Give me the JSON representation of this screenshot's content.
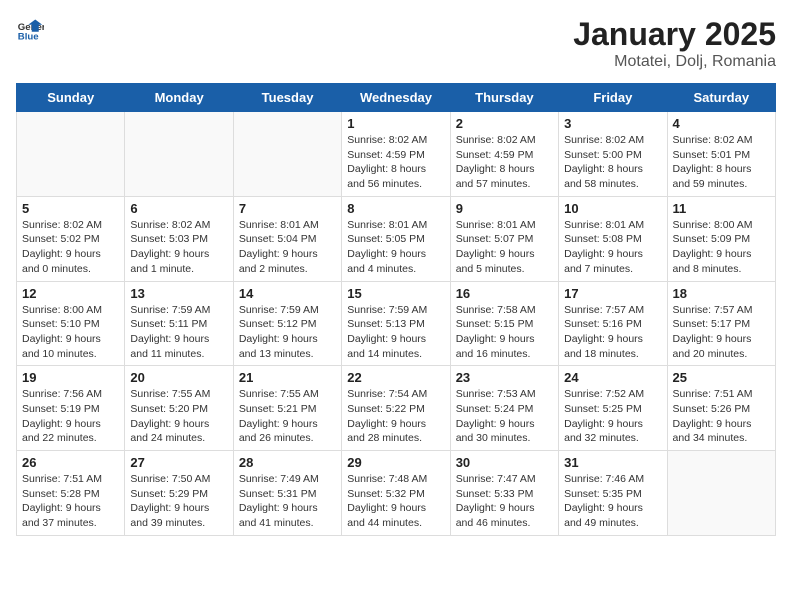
{
  "logo": {
    "text_general": "General",
    "text_blue": "Blue"
  },
  "title": "January 2025",
  "subtitle": "Motatei, Dolj, Romania",
  "weekdays": [
    "Sunday",
    "Monday",
    "Tuesday",
    "Wednesday",
    "Thursday",
    "Friday",
    "Saturday"
  ],
  "weeks": [
    [
      {
        "day": "",
        "detail": ""
      },
      {
        "day": "",
        "detail": ""
      },
      {
        "day": "",
        "detail": ""
      },
      {
        "day": "1",
        "detail": "Sunrise: 8:02 AM\nSunset: 4:59 PM\nDaylight: 8 hours\nand 56 minutes."
      },
      {
        "day": "2",
        "detail": "Sunrise: 8:02 AM\nSunset: 4:59 PM\nDaylight: 8 hours\nand 57 minutes."
      },
      {
        "day": "3",
        "detail": "Sunrise: 8:02 AM\nSunset: 5:00 PM\nDaylight: 8 hours\nand 58 minutes."
      },
      {
        "day": "4",
        "detail": "Sunrise: 8:02 AM\nSunset: 5:01 PM\nDaylight: 8 hours\nand 59 minutes."
      }
    ],
    [
      {
        "day": "5",
        "detail": "Sunrise: 8:02 AM\nSunset: 5:02 PM\nDaylight: 9 hours\nand 0 minutes."
      },
      {
        "day": "6",
        "detail": "Sunrise: 8:02 AM\nSunset: 5:03 PM\nDaylight: 9 hours\nand 1 minute."
      },
      {
        "day": "7",
        "detail": "Sunrise: 8:01 AM\nSunset: 5:04 PM\nDaylight: 9 hours\nand 2 minutes."
      },
      {
        "day": "8",
        "detail": "Sunrise: 8:01 AM\nSunset: 5:05 PM\nDaylight: 9 hours\nand 4 minutes."
      },
      {
        "day": "9",
        "detail": "Sunrise: 8:01 AM\nSunset: 5:07 PM\nDaylight: 9 hours\nand 5 minutes."
      },
      {
        "day": "10",
        "detail": "Sunrise: 8:01 AM\nSunset: 5:08 PM\nDaylight: 9 hours\nand 7 minutes."
      },
      {
        "day": "11",
        "detail": "Sunrise: 8:00 AM\nSunset: 5:09 PM\nDaylight: 9 hours\nand 8 minutes."
      }
    ],
    [
      {
        "day": "12",
        "detail": "Sunrise: 8:00 AM\nSunset: 5:10 PM\nDaylight: 9 hours\nand 10 minutes."
      },
      {
        "day": "13",
        "detail": "Sunrise: 7:59 AM\nSunset: 5:11 PM\nDaylight: 9 hours\nand 11 minutes."
      },
      {
        "day": "14",
        "detail": "Sunrise: 7:59 AM\nSunset: 5:12 PM\nDaylight: 9 hours\nand 13 minutes."
      },
      {
        "day": "15",
        "detail": "Sunrise: 7:59 AM\nSunset: 5:13 PM\nDaylight: 9 hours\nand 14 minutes."
      },
      {
        "day": "16",
        "detail": "Sunrise: 7:58 AM\nSunset: 5:15 PM\nDaylight: 9 hours\nand 16 minutes."
      },
      {
        "day": "17",
        "detail": "Sunrise: 7:57 AM\nSunset: 5:16 PM\nDaylight: 9 hours\nand 18 minutes."
      },
      {
        "day": "18",
        "detail": "Sunrise: 7:57 AM\nSunset: 5:17 PM\nDaylight: 9 hours\nand 20 minutes."
      }
    ],
    [
      {
        "day": "19",
        "detail": "Sunrise: 7:56 AM\nSunset: 5:19 PM\nDaylight: 9 hours\nand 22 minutes."
      },
      {
        "day": "20",
        "detail": "Sunrise: 7:55 AM\nSunset: 5:20 PM\nDaylight: 9 hours\nand 24 minutes."
      },
      {
        "day": "21",
        "detail": "Sunrise: 7:55 AM\nSunset: 5:21 PM\nDaylight: 9 hours\nand 26 minutes."
      },
      {
        "day": "22",
        "detail": "Sunrise: 7:54 AM\nSunset: 5:22 PM\nDaylight: 9 hours\nand 28 minutes."
      },
      {
        "day": "23",
        "detail": "Sunrise: 7:53 AM\nSunset: 5:24 PM\nDaylight: 9 hours\nand 30 minutes."
      },
      {
        "day": "24",
        "detail": "Sunrise: 7:52 AM\nSunset: 5:25 PM\nDaylight: 9 hours\nand 32 minutes."
      },
      {
        "day": "25",
        "detail": "Sunrise: 7:51 AM\nSunset: 5:26 PM\nDaylight: 9 hours\nand 34 minutes."
      }
    ],
    [
      {
        "day": "26",
        "detail": "Sunrise: 7:51 AM\nSunset: 5:28 PM\nDaylight: 9 hours\nand 37 minutes."
      },
      {
        "day": "27",
        "detail": "Sunrise: 7:50 AM\nSunset: 5:29 PM\nDaylight: 9 hours\nand 39 minutes."
      },
      {
        "day": "28",
        "detail": "Sunrise: 7:49 AM\nSunset: 5:31 PM\nDaylight: 9 hours\nand 41 minutes."
      },
      {
        "day": "29",
        "detail": "Sunrise: 7:48 AM\nSunset: 5:32 PM\nDaylight: 9 hours\nand 44 minutes."
      },
      {
        "day": "30",
        "detail": "Sunrise: 7:47 AM\nSunset: 5:33 PM\nDaylight: 9 hours\nand 46 minutes."
      },
      {
        "day": "31",
        "detail": "Sunrise: 7:46 AM\nSunset: 5:35 PM\nDaylight: 9 hours\nand 49 minutes."
      },
      {
        "day": "",
        "detail": ""
      }
    ]
  ]
}
